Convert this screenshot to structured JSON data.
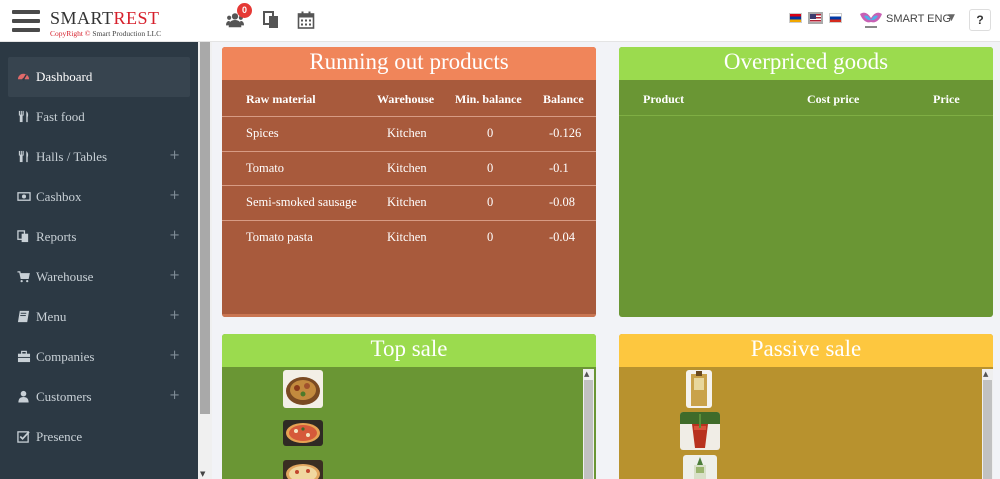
{
  "header": {
    "brand_main": "SMART",
    "brand_accent": "REST",
    "copyright_prefix": "CopyRight ©",
    "copyright_owner": "Smart Production LLC",
    "notification_count": "0",
    "user_name": "SMART ENG",
    "help_label": "?",
    "languages": [
      "hy",
      "en",
      "ru"
    ]
  },
  "sidebar": {
    "items": [
      {
        "label": "Dashboard",
        "icon": "dashboard-icon",
        "expandable": false,
        "active": true
      },
      {
        "label": "Fast food",
        "icon": "utensils-icon",
        "expandable": false
      },
      {
        "label": "Halls / Tables",
        "icon": "utensils-icon",
        "expandable": true
      },
      {
        "label": "Cashbox",
        "icon": "money-icon",
        "expandable": true
      },
      {
        "label": "Reports",
        "icon": "copy-icon",
        "expandable": true
      },
      {
        "label": "Warehouse",
        "icon": "cart-icon",
        "expandable": true
      },
      {
        "label": "Menu",
        "icon": "book-icon",
        "expandable": true
      },
      {
        "label": "Companies",
        "icon": "briefcase-icon",
        "expandable": true
      },
      {
        "label": "Customers",
        "icon": "user-icon",
        "expandable": true
      },
      {
        "label": "Presence",
        "icon": "check-square-icon",
        "expandable": false
      }
    ],
    "expand_symbol": "+"
  },
  "running_out": {
    "title": "Running out products",
    "columns": [
      "Raw material",
      "Warehouse",
      "Min. balance",
      "Balance"
    ],
    "rows": [
      [
        "Spices",
        "Kitchen",
        "0",
        "-0.126"
      ],
      [
        "Tomato",
        "Kitchen",
        "0",
        "-0.1"
      ],
      [
        "Semi-smoked sausage",
        "Kitchen",
        "0",
        "-0.08"
      ],
      [
        "Tomato pasta",
        "Kitchen",
        "0",
        "-0.04"
      ]
    ]
  },
  "overpriced": {
    "title": "Overpriced goods",
    "columns": [
      "Product",
      "Cost price",
      "Price"
    ]
  },
  "top_sale": {
    "title": "Top sale"
  },
  "passive_sale": {
    "title": "Passive sale"
  },
  "colors": {
    "sidebar_bg": "#2c3944",
    "running_out_header": "#f0855a",
    "running_out_body": "#a85a3c",
    "green_header": "#9bdb4e",
    "green_body": "#6a9634",
    "passive_header": "#fdc73f",
    "passive_body": "#b8922e",
    "brand_red": "#d61f2b"
  }
}
